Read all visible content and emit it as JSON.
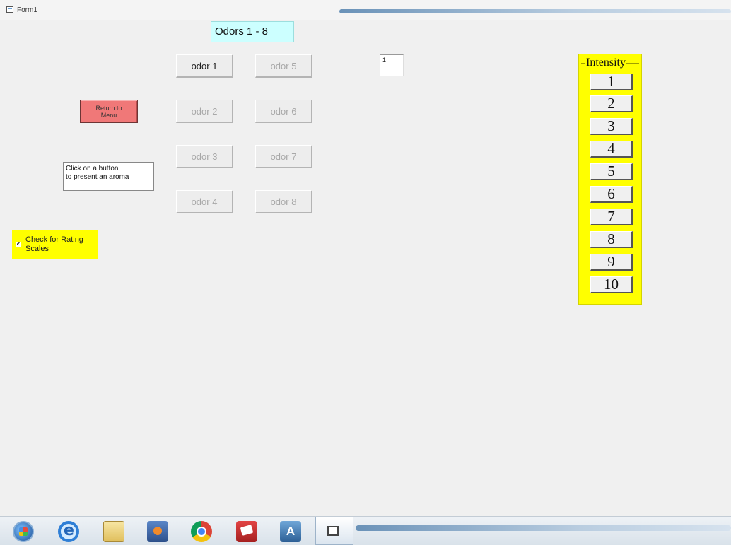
{
  "window": {
    "title": "Form1"
  },
  "form_title": "Odors 1 - 8",
  "odor_buttons": [
    {
      "label": "odor 1"
    },
    {
      "label": "odor 5"
    },
    {
      "label": "odor 2"
    },
    {
      "label": "odor 6"
    },
    {
      "label": "odor 3"
    },
    {
      "label": "odor 7"
    },
    {
      "label": "odor 4"
    },
    {
      "label": "odor 8"
    }
  ],
  "counter_box": {
    "value": "1"
  },
  "return_button": {
    "line1": "Return to",
    "line2": "Menu"
  },
  "hint": {
    "line1": "Click on a button",
    "line2": "to present an aroma"
  },
  "rating_checkbox": {
    "line1": "Check for Rating",
    "line2": "Scales",
    "checked": true,
    "mark": "✔"
  },
  "intensity": {
    "title": "Intensity",
    "buttons": [
      "1",
      "2",
      "3",
      "4",
      "5",
      "6",
      "7",
      "8",
      "9",
      "10"
    ]
  },
  "taskbar": {
    "icons": [
      "windows-start-icon",
      "internet-explorer-icon",
      "file-explorer-icon",
      "media-player-icon",
      "chrome-icon",
      "book-app-icon",
      "app-a-icon",
      "form-app-icon"
    ],
    "appa_label": "A"
  }
}
